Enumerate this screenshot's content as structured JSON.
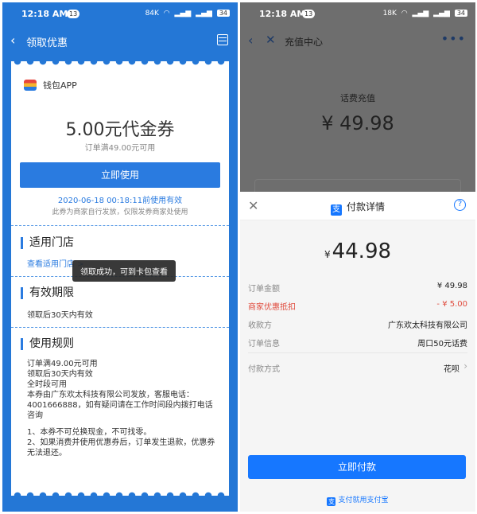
{
  "left": {
    "status": {
      "time": "12:18 AM",
      "notif_count": "13",
      "net_speed": "84K",
      "battery": "34"
    },
    "nav": {
      "title": "领取优惠"
    },
    "coupon": {
      "wallet_label": "钱包APP",
      "amount": "5.00元代金券",
      "condition": "订单满49.00元可用",
      "use_button": "立即使用",
      "expiry": "2020-06-18 00:18:11前使用有效",
      "expiry_note": "此券为商家自行发放，仅限发券商家处使用"
    },
    "stores": {
      "title": "适用门店",
      "link": "查看适用门店 >"
    },
    "validity": {
      "title": "有效期限",
      "text": "领取后30天内有效"
    },
    "rules": {
      "title": "使用规则",
      "lines": [
        "订单满49.00元可用",
        "领取后30天内有效",
        "全时段可用",
        "本券由广东欢太科技有限公司发放，客服电话：4001666888，如有疑问请在工作时间段内拨打电话咨询",
        "",
        "1、本券不可兑换现金，不可找零。",
        "2、如果消费并使用优惠券后，订单发生退款，优惠券无法退还。"
      ]
    },
    "toast": "领取成功，可到卡包查看"
  },
  "right": {
    "status": {
      "time": "12:18 AM",
      "notif_count": "13",
      "net_speed": "18K",
      "battery": "34"
    },
    "nav": {
      "title": "充值中心",
      "more": "•••"
    },
    "recharge": {
      "label": "话费充值",
      "price": "¥ 49.98"
    },
    "sheet": {
      "title": "付款详情",
      "help": "?",
      "currency": "¥",
      "pay_amount": "44.98",
      "rows": [
        {
          "key": "订单金额",
          "value": "¥ 49.98"
        },
        {
          "key": "商家优惠抵扣",
          "value": "- ¥ 5.00"
        },
        {
          "key": "收款方",
          "value": "广东欢太科技有限公司"
        },
        {
          "key": "订单信息",
          "value": "周口50元话费"
        },
        {
          "key": "付款方式",
          "value": "花呗"
        }
      ],
      "pay_button": "立即付款",
      "footer": "支付就用支付宝"
    }
  },
  "colors": {
    "brand_blue": "#2477d6",
    "alipay_blue": "#1677ff",
    "discount_red": "#e04b3d"
  }
}
